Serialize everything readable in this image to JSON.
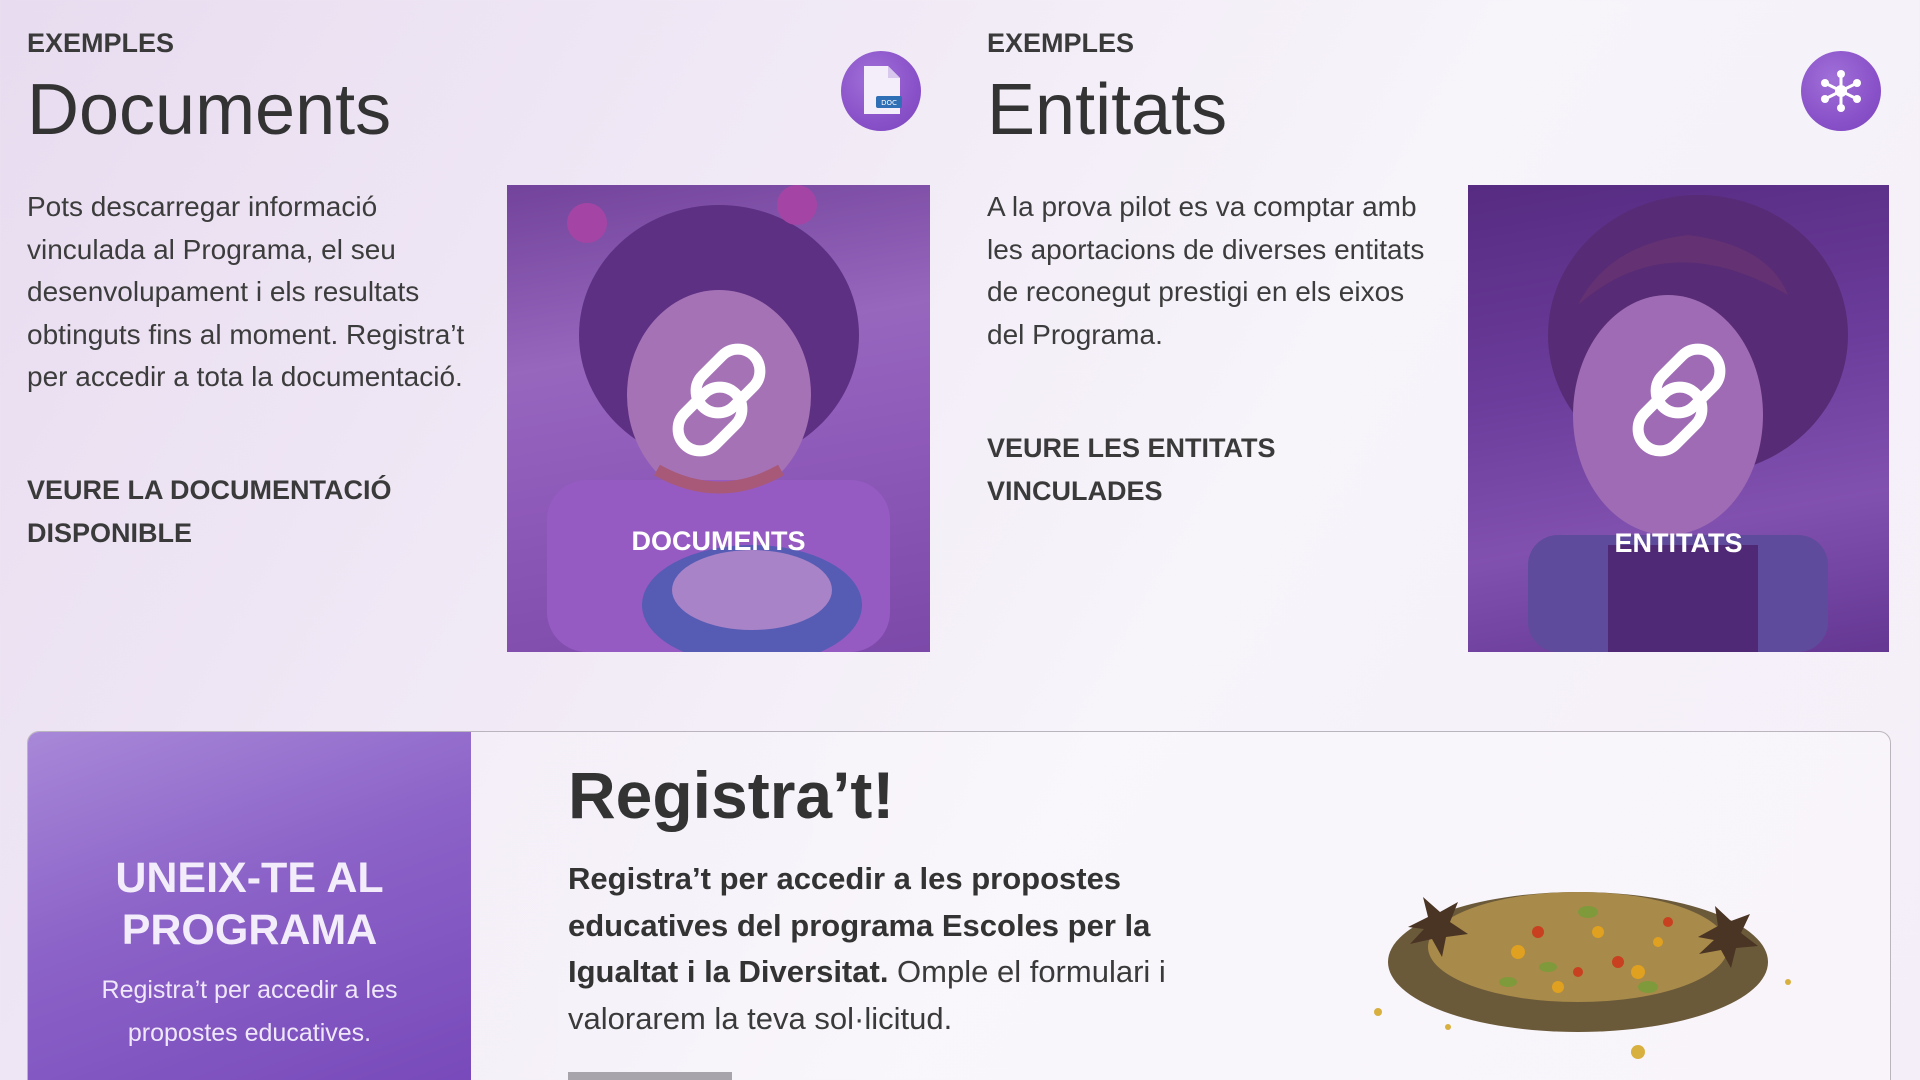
{
  "documents": {
    "eyebrow": "EXEMPLES",
    "title": "Documents",
    "icon": "doc-file-icon",
    "icon_text": "DOC",
    "description": "Pots descarregar informació vinculada al Programa, el seu desenvolupament i els resultats obtinguts fins al moment. Registra’t per accedir a tota la documentació.",
    "cta_line1": "VEURE LA DOCUMENTACIÓ",
    "cta_line2": "DISPONIBLE",
    "card_label": "DOCUMENTS"
  },
  "entities": {
    "eyebrow": "EXEMPLES",
    "title": "Entitats",
    "icon": "network-icon",
    "description": "A la prova pilot es va comptar amb les aportacions de diverses entitats de reconegut prestigi en els eixos del Programa.",
    "cta_line1": "VEURE LES ENTITATS",
    "cta_line2": "VINCULADES",
    "card_label": "ENTITATS"
  },
  "join": {
    "title_line1": "UNEIX-TE AL",
    "title_line2": "PROGRAMA",
    "subtitle_line1": "Registra’t per accedir a les",
    "subtitle_line2": "propostes educatives."
  },
  "register": {
    "title": "Registra’t!",
    "text_bold": "Registra’t per accedir a les propostes educatives del programa Escoles per la Igualtat i la Diversitat.",
    "text_regular": " Omple el formulari i valorarem la teva sol·licitud."
  },
  "colors": {
    "accent_purple": "#8a52c9",
    "overlay_purple": "#6e32aa",
    "text_dark": "#333333"
  }
}
